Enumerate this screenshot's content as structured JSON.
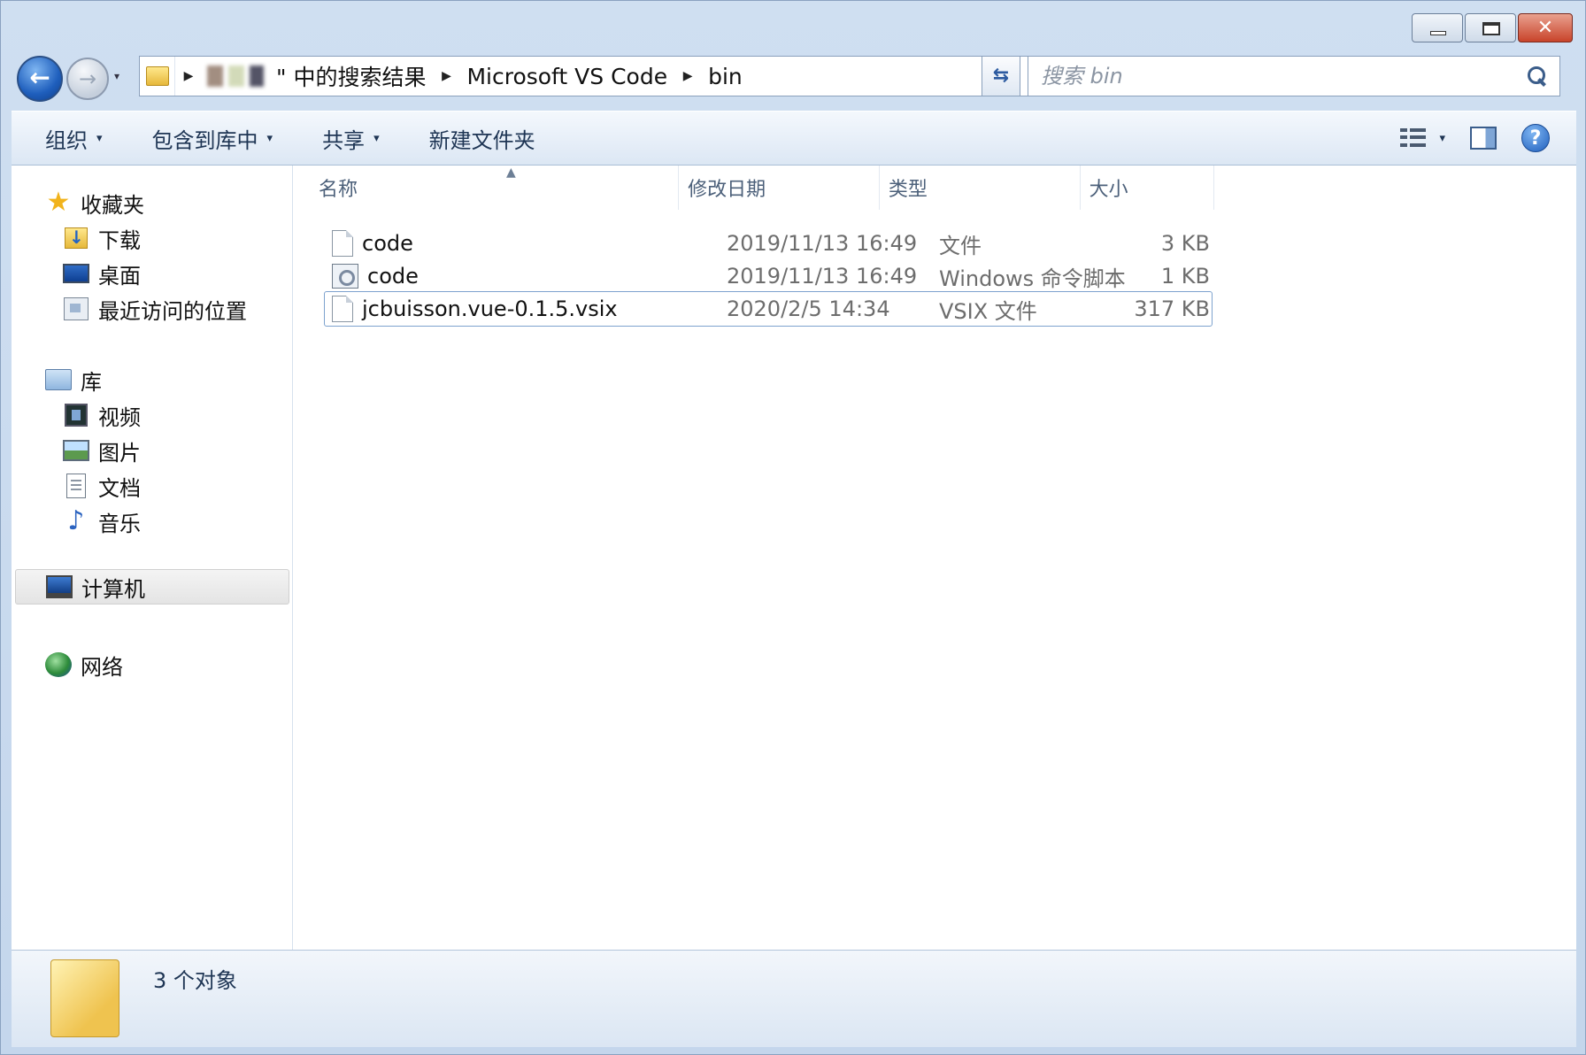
{
  "window": {
    "caption": {
      "minimize": "",
      "maximize": "",
      "close": "✕"
    }
  },
  "nav": {
    "back_glyph": "←",
    "forward_glyph": "→",
    "history_glyph": "▾",
    "breadcrumb": {
      "search_results_suffix": "\" 中的搜索结果",
      "segments": [
        "Microsoft VS Code",
        "bin"
      ]
    },
    "search": {
      "placeholder": "搜索 bin"
    },
    "refresh_glyph": "⇆"
  },
  "toolbar": {
    "organize": "组织",
    "include_in_library": "包含到库中",
    "share": "共享",
    "new_folder": "新建文件夹",
    "caret": "▾"
  },
  "sidebar": {
    "favorites": {
      "label": "收藏夹",
      "items": [
        "下载",
        "桌面",
        "最近访问的位置"
      ]
    },
    "libraries": {
      "label": "库",
      "items": [
        "视频",
        "图片",
        "文档",
        "音乐"
      ]
    },
    "computer": {
      "label": "计算机"
    },
    "network": {
      "label": "网络"
    }
  },
  "file_list": {
    "columns": {
      "name": "名称",
      "modified": "修改日期",
      "type": "类型",
      "size": "大小"
    },
    "rows": [
      {
        "name": "code",
        "modified": "2019/11/13 16:49",
        "type": "文件",
        "size": "3 KB",
        "icon": "blank-file-icon"
      },
      {
        "name": "code",
        "modified": "2019/11/13 16:49",
        "type": "Windows 命令脚本",
        "size": "1 KB",
        "icon": "script-file-icon"
      },
      {
        "name": "jcbuisson.vue-0.1.5.vsix",
        "modified": "2020/2/5 14:34",
        "type": "VSIX 文件",
        "size": "317 KB",
        "icon": "blank-file-icon"
      }
    ]
  },
  "status": {
    "count_text": "3 个对象"
  },
  "colors": {
    "accent": "#1f5fbd",
    "close": "#c8432a",
    "folder": "#e6b83b"
  }
}
